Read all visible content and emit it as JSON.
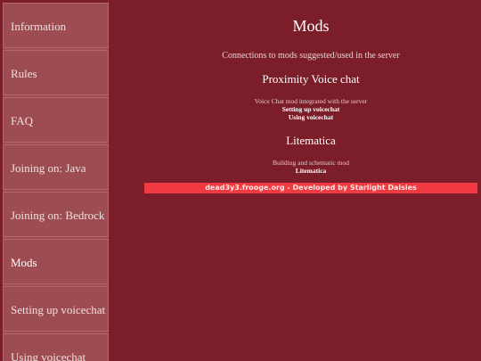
{
  "sidebar": {
    "items": [
      {
        "label": "Information"
      },
      {
        "label": "Rules"
      },
      {
        "label": "FAQ"
      },
      {
        "label": "Joining on: Java"
      },
      {
        "label": "Joining on: Bedrock"
      },
      {
        "label": "Mods"
      },
      {
        "label": "Setting up voicechat"
      },
      {
        "label": "Using voicechat"
      }
    ],
    "active": "Mods"
  },
  "main": {
    "title": "Mods",
    "subtitle": "Connections to mods suggested/used in the server",
    "mods": [
      {
        "name": "Proximity Voice chat",
        "description": "Voice Chat mod integrated with the server",
        "links": [
          "Setting up voicechat",
          "Using voicechat"
        ]
      },
      {
        "name": "Litematica",
        "description": "Building and schematic mod",
        "links": [
          "Litematica"
        ]
      }
    ]
  },
  "footer": {
    "text": "dead3y3.frooge.org - Developed by Starlight Daisies"
  },
  "colors": {
    "background": "#7b1e2a",
    "sidebar": "#9d4d52",
    "footer_bar": "#f13a3f"
  }
}
